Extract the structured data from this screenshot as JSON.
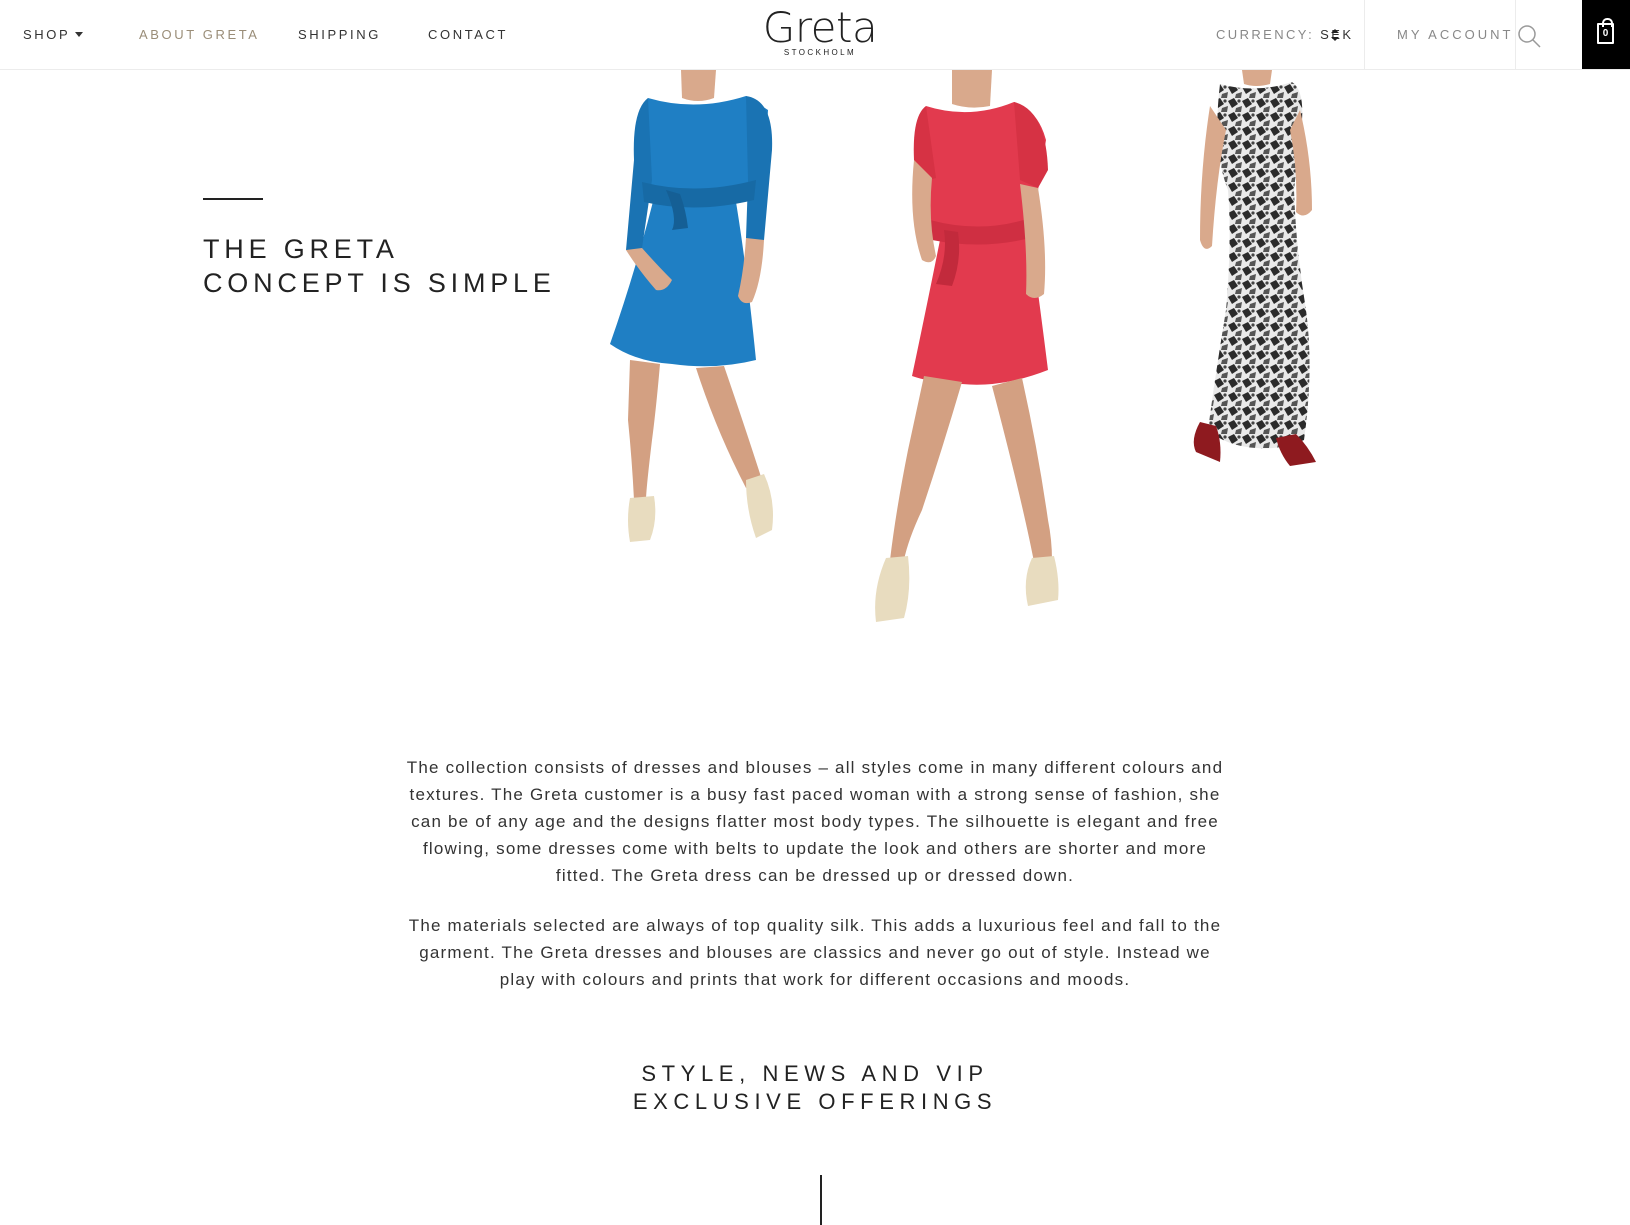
{
  "nav": {
    "shop": "SHOP",
    "about": "ABOUT GRETA",
    "shipping": "SHIPPING",
    "contact": "CONTACT"
  },
  "logo": {
    "word": "Greta",
    "sub": "STOCKHOLM"
  },
  "currency": {
    "label": "CURRENCY:",
    "value": "SEK"
  },
  "account": {
    "label": "MY ACCOUNT"
  },
  "cart": {
    "count": "0"
  },
  "hero": {
    "title": "THE GRETA CONCEPT IS SIMPLE",
    "models": [
      {
        "name": "blue-dress",
        "color": "#1f7fc4"
      },
      {
        "name": "red-dress",
        "color": "#e23a4e"
      },
      {
        "name": "printed-maxi-dress",
        "color": "#7a7a7a"
      }
    ]
  },
  "about": {
    "p1": "The collection consists of dresses and blouses – all styles come in many different colours and textures. The Greta customer is a busy fast paced woman with a strong sense of fashion, she can be of any age and the designs flatter most body types. The silhouette is elegant and free flowing, some dresses come with belts to update the look and others are shorter and more fitted. The Greta dress can be dressed up or dressed down.",
    "p2": "The materials selected are always of top quality silk. This adds a luxurious feel and fall to the garment. The Greta dresses and blouses are classics and never go out of style. Instead we play with colours and prints that work for different occasions and moods."
  },
  "newsletter": {
    "title": "STYLE, NEWS AND VIP EXCLUSIVE OFFERINGS"
  },
  "icons": {
    "search": "search-icon",
    "cart": "bag-icon",
    "shop_caret": "caret-down-icon",
    "currency_toggle": "sort-arrows-icon"
  }
}
